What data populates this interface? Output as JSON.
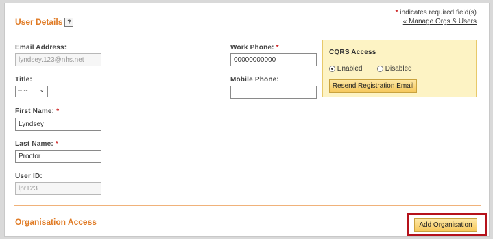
{
  "user_details": {
    "title": "User Details",
    "help": "?",
    "required_star": "*",
    "required_note": "indicates required field(s)",
    "manage_link": "« Manage Orgs & Users"
  },
  "fields": {
    "email": {
      "label": "Email Address:",
      "value": "lyndsey.123@nhs.net"
    },
    "title": {
      "label": "Title:",
      "value": "-- --"
    },
    "first_name": {
      "label": "First Name:",
      "star": "*",
      "value": "Lyndsey"
    },
    "last_name": {
      "label": "Last Name:",
      "star": "*",
      "value": "Proctor"
    },
    "user_id": {
      "label": "User ID:",
      "value": "lpr123"
    },
    "work_phone": {
      "label": "Work Phone:",
      "star": "*",
      "value": "00000000000"
    },
    "mobile_phone": {
      "label": "Mobile Phone:",
      "value": ""
    }
  },
  "cqrs": {
    "title": "CQRS Access",
    "enabled_label": "Enabled",
    "disabled_label": "Disabled",
    "selected": "Enabled",
    "resend_button": "Resend Registration Email"
  },
  "org_access": {
    "title": "Organisation Access",
    "add_button": "Add Organisation"
  },
  "colors": {
    "accent": "#e07b25",
    "highlight": "#b5121b",
    "cqrs_bg": "#fdf3c4"
  }
}
